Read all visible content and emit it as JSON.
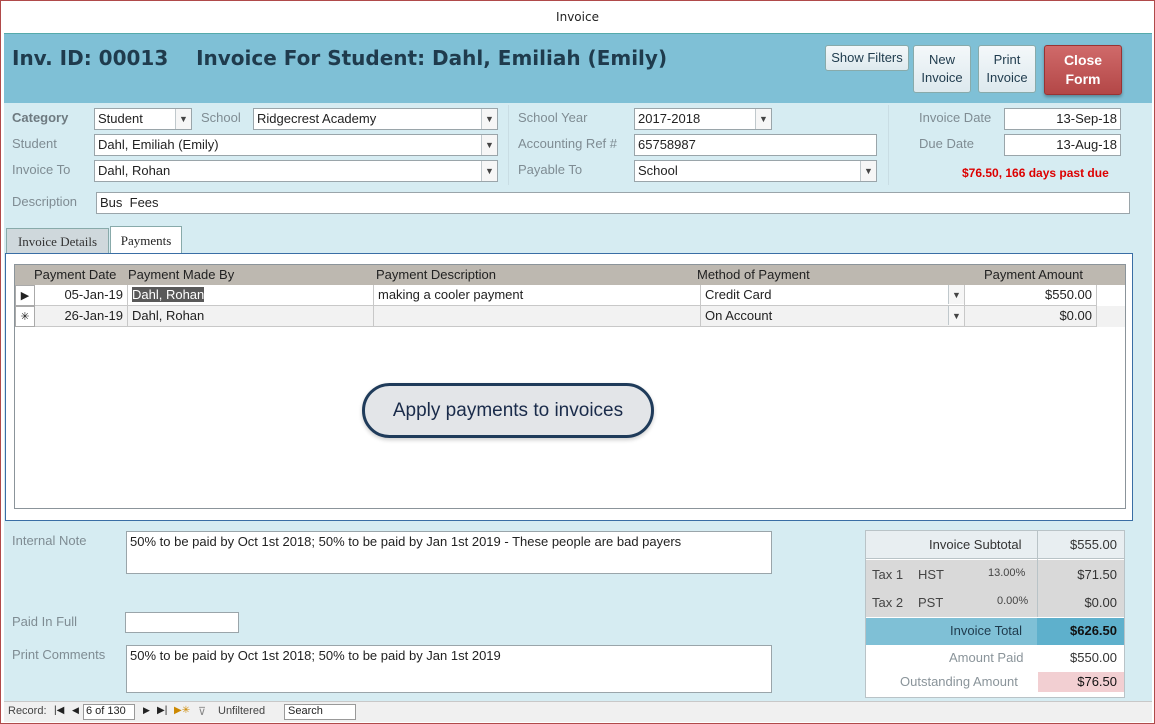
{
  "window": {
    "title": "Invoice"
  },
  "header": {
    "title": "Inv. ID: 00013    Invoice For Student: Dahl, Emiliah (Emily)",
    "buttons": {
      "show_filters": "Show Filters",
      "new_invoice": [
        "New",
        "Invoice"
      ],
      "print_invoice": [
        "Print",
        "Invoice"
      ],
      "close_form": [
        "Close",
        "Form"
      ]
    }
  },
  "fields": {
    "category": {
      "label": "Category",
      "value": "Student"
    },
    "school": {
      "label": "School",
      "value": "Ridgecrest Academy"
    },
    "student": {
      "label": "Student",
      "value": "Dahl, Emiliah (Emily)"
    },
    "invoice_to": {
      "label": "Invoice To",
      "value": "Dahl, Rohan"
    },
    "school_year": {
      "label": "School Year",
      "value": "2017-2018"
    },
    "accounting_ref": {
      "label": "Accounting Ref #",
      "value": "65758987"
    },
    "payable_to": {
      "label": "Payable To",
      "value": "School"
    },
    "invoice_date": {
      "label": "Invoice Date",
      "value": "13-Sep-18"
    },
    "due_date": {
      "label": "Due Date",
      "value": "13-Aug-18"
    },
    "past_due": "$76.50, 166 days past due",
    "description": {
      "label": "Description",
      "value": "Bus  Fees"
    }
  },
  "tabs": [
    "Invoice Details",
    "Payments"
  ],
  "payments": {
    "columns": [
      "Payment Date",
      "Payment Made By",
      "Payment Description",
      "Method of Payment",
      "Payment Amount"
    ],
    "rows": [
      {
        "selector": "▶",
        "date": "05-Jan-19",
        "by": "Dahl, Rohan",
        "desc": "making a cooler payment",
        "method": "Credit Card",
        "amount": "$550.00"
      },
      {
        "selector": "✳",
        "date": "26-Jan-19",
        "by": "Dahl, Rohan",
        "desc": "",
        "method": "On Account",
        "amount": "$0.00"
      }
    ]
  },
  "callout": "Apply payments to invoices",
  "notes": {
    "internal_note": {
      "label": "Internal Note",
      "value": "50% to be paid by Oct 1st 2018; 50% to be paid by Jan 1st 2019 - These people are bad payers"
    },
    "paid_in_full": {
      "label": "Paid In Full",
      "value": ""
    },
    "print_comments": {
      "label": "Print Comments",
      "value": "50% to be paid by Oct 1st 2018; 50% to be paid by Jan 1st 2019"
    }
  },
  "totals": {
    "subtotal": {
      "label": "Invoice Subtotal",
      "value": "$555.00"
    },
    "tax1": {
      "label": "Tax 1",
      "name": "HST",
      "rate": "13.00%",
      "value": "$71.50"
    },
    "tax2": {
      "label": "Tax 2",
      "name": "PST",
      "rate": "0.00%",
      "value": "$0.00"
    },
    "total": {
      "label": "Invoice Total",
      "value": "$626.50"
    },
    "amount_paid": {
      "label": "Amount Paid",
      "value": "$550.00"
    },
    "outstanding": {
      "label": "Outstanding Amount",
      "value": "$76.50"
    }
  },
  "statusbar": {
    "record_label": "Record:",
    "record_value": "6 of 130",
    "filter": "Unfiltered",
    "search": "Search"
  },
  "colors": {
    "header_bg": "#7fc0d6",
    "form_bg": "#d6ecf2",
    "close_button": "#b34747",
    "total_bg": "#7fc0d6",
    "past_due": "#dd0000",
    "outstanding_bg": "#f2cfd2"
  }
}
